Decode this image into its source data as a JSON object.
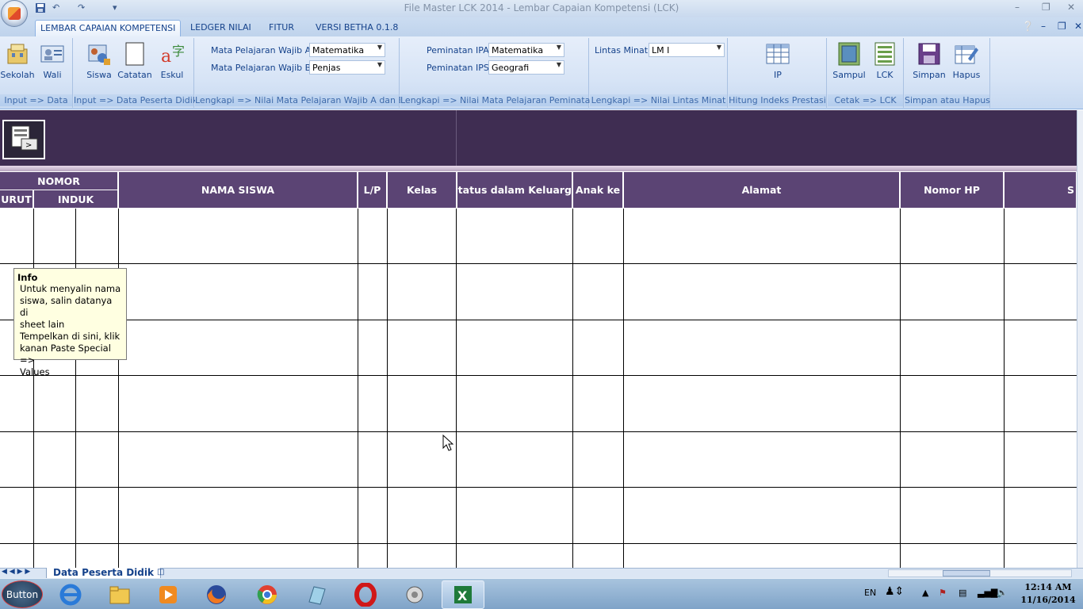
{
  "window": {
    "title": "File Master LCK 2014  -  Lembar Capaian Kompetensi (LCK)",
    "qat_undo": "↶",
    "qat_redo": "↷"
  },
  "tabs": [
    {
      "label": "LEMBAR CAPAIAN KOMPETENSI"
    },
    {
      "label": "LEDGER NILAI"
    },
    {
      "label": "FITUR"
    },
    {
      "label": "VERSI BETHA 0.1.8"
    }
  ],
  "ribbon": {
    "groups": [
      {
        "label": "Input => Data",
        "buttons": [
          "Sekolah",
          "Wali"
        ]
      },
      {
        "label": "Input => Data Peserta Didik",
        "buttons": [
          "Siswa",
          "Catatan",
          "Eskul"
        ]
      },
      {
        "label": "Lengkapi => Nilai Mata Pelajaran Wajib A dan B"
      },
      {
        "label": "Lengkapi => Nilai Mata Pelajaran Peminatan"
      },
      {
        "label": "Lengkapi => Nilai Lintas Minat"
      },
      {
        "label": "Hitung Indeks Prestasi",
        "buttons": [
          "IP"
        ]
      },
      {
        "label": "Cetak => LCK",
        "buttons": [
          "Sampul",
          "LCK"
        ]
      },
      {
        "label": "Simpan atau Hapus",
        "buttons": [
          "Simpan",
          "Hapus"
        ]
      }
    ],
    "fields": {
      "wajib_a_label": "Mata Pelajaran Wajib A",
      "wajib_a_value": "Matematika",
      "wajib_b_label": "Mata Pelajaran Wajib B",
      "wajib_b_value": "Penjas",
      "ipa_label": "Peminatan IPA",
      "ipa_value": "Matematika",
      "ips_label": "Peminatan IPS",
      "ips_value": "Geografi",
      "lintas_label": "Lintas Minat",
      "lintas_value": "LM I"
    }
  },
  "table": {
    "nomor": "NOMOR",
    "urut": "URUT",
    "induk": "INDUK",
    "columns": [
      "NAMA SISWA",
      "L/P",
      "Kelas",
      "Status dalam Keluarga",
      "Anak ke",
      "Alamat",
      "Nomor HP",
      "S"
    ]
  },
  "tooltip": {
    "title": "Info",
    "body": "Untuk menyalin nama\nsiswa, salin datanya di\nsheet lain\nTempelkan di sini, klik\nkanan Paste Special =>\nValues"
  },
  "sheet_tab": "Data Peserta Didik",
  "taskbar": {
    "start_label": "Button",
    "lang": "EN",
    "time": "12:14 AM",
    "date": "11/16/2014"
  }
}
